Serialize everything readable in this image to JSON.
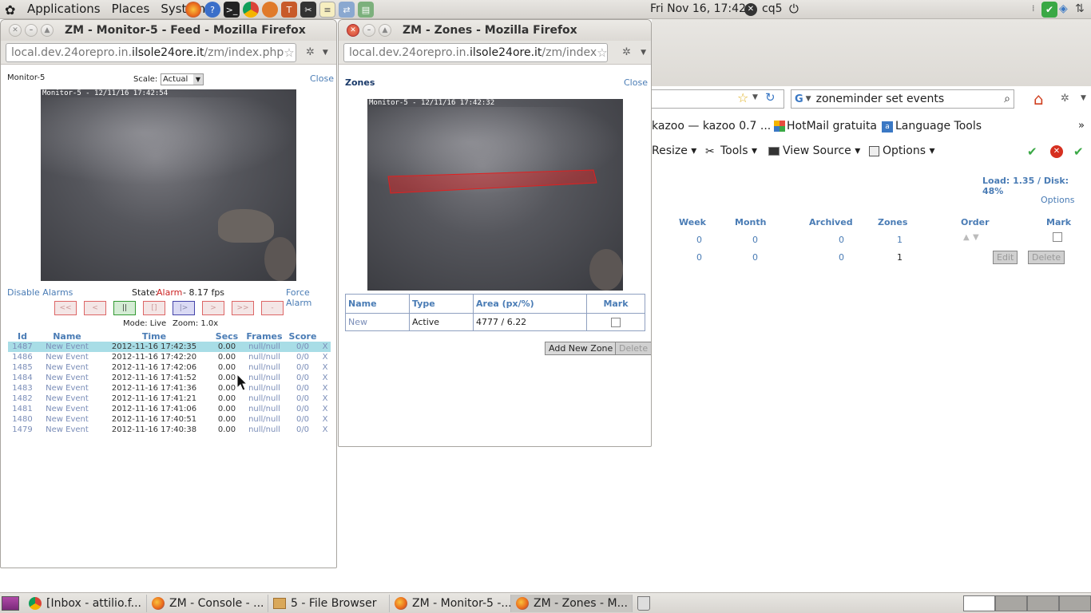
{
  "top_panel": {
    "menus": [
      "Applications",
      "Places",
      "System"
    ],
    "clock": "Fri Nov 16, 17:42",
    "user": "cq5"
  },
  "feed_window": {
    "title": "ZM - Monitor-5 - Feed - Mozilla Firefox",
    "url_pre": "local.dev.24orepro.in.",
    "url_domain": "ilsole24ore.it",
    "url_post": "/zm/index.php",
    "monitor_name": "Monitor-5",
    "scale_label": "Scale:",
    "scale_value": "Actual",
    "close": "Close",
    "timestamp": "Monitor-5 - 12/11/16 17:42:54",
    "disable_alarms": "Disable Alarms",
    "state_label": "State:",
    "state_value": "Alarm",
    "fps": "- 8.17 fps",
    "force_alarm": "Force Alarm",
    "controls": [
      "<<",
      "<",
      "||",
      "[]",
      "|>",
      ">",
      ">>",
      "-"
    ],
    "mode": "Mode: Live",
    "zoom": "Zoom: 1.0x",
    "events_headers": [
      "Id",
      "Name",
      "Time",
      "Secs",
      "Frames",
      "Score",
      ""
    ],
    "events": [
      [
        "1487",
        "New Event",
        "2012-11-16 17:42:35",
        "0.00",
        "null/null",
        "0/0",
        "X"
      ],
      [
        "1486",
        "New Event",
        "2012-11-16 17:42:20",
        "0.00",
        "null/null",
        "0/0",
        "X"
      ],
      [
        "1485",
        "New Event",
        "2012-11-16 17:42:06",
        "0.00",
        "null/null",
        "0/0",
        "X"
      ],
      [
        "1484",
        "New Event",
        "2012-11-16 17:41:52",
        "0.00",
        "null/null",
        "0/0",
        "X"
      ],
      [
        "1483",
        "New Event",
        "2012-11-16 17:41:36",
        "0.00",
        "null/null",
        "0/0",
        "X"
      ],
      [
        "1482",
        "New Event",
        "2012-11-16 17:41:21",
        "0.00",
        "null/null",
        "0/0",
        "X"
      ],
      [
        "1481",
        "New Event",
        "2012-11-16 17:41:06",
        "0.00",
        "null/null",
        "0/0",
        "X"
      ],
      [
        "1480",
        "New Event",
        "2012-11-16 17:40:51",
        "0.00",
        "null/null",
        "0/0",
        "X"
      ],
      [
        "1479",
        "New Event",
        "2012-11-16 17:40:38",
        "0.00",
        "null/null",
        "0/0",
        "X"
      ]
    ]
  },
  "zones_window": {
    "title": "ZM - Zones - Mozilla Firefox",
    "url_pre": "local.dev.24orepro.in.",
    "url_domain": "ilsole24ore.it",
    "url_post": "/zm/index",
    "heading": "Zones",
    "close": "Close",
    "timestamp": "Monitor-5 - 12/11/16 17:42:32",
    "table_headers": [
      "Name",
      "Type",
      "Area (px/%)",
      "Mark"
    ],
    "zone": {
      "name": "New",
      "type": "Active",
      "area": "4777 / 6.22"
    },
    "add_button": "Add New Zone",
    "delete_button": "Delete"
  },
  "console_window": {
    "search_text": "zoneminder set events",
    "bookmarks": [
      "kazoo — kazoo 0.7 ...",
      "HotMail gratuita",
      "Language Tools"
    ],
    "toolbar": [
      "Resize",
      "Tools",
      "View Source",
      "Options"
    ],
    "load": "Load: 1.35 / Disk: 48%",
    "options": "Options",
    "headers": [
      "Week",
      "Month",
      "Archived",
      "Zones",
      "Order",
      "Mark"
    ],
    "rows": [
      [
        "0",
        "0",
        "0",
        "1"
      ],
      [
        "0",
        "0",
        "0",
        "1"
      ]
    ],
    "edit": "Edit",
    "delete": "Delete"
  },
  "taskbar": {
    "tasks": [
      "[Inbox - attilio.f...",
      "ZM - Console - ...",
      "5 - File Browser",
      "ZM - Monitor-5 -...",
      "ZM - Zones - M..."
    ]
  },
  "colors": {
    "link": "#4a7cb5",
    "alarm": "#cc2222",
    "zone": "#e02020",
    "selected_row": "#a8dde6"
  }
}
